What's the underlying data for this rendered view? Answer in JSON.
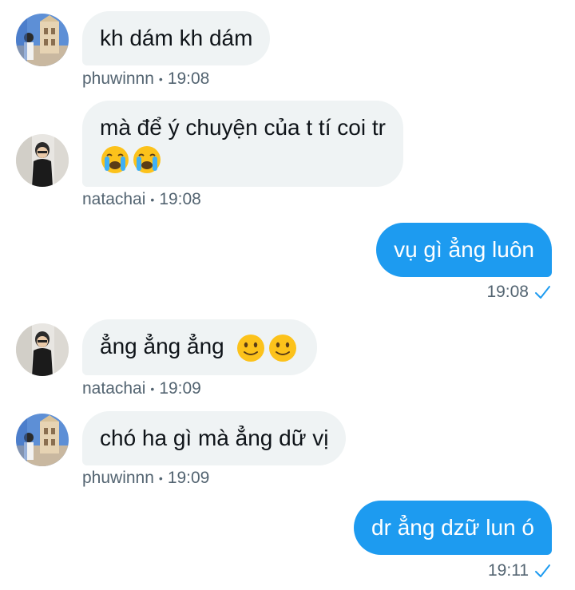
{
  "messages": [
    {
      "direction": "in",
      "avatar_icon": "avatar-building-photo",
      "text": "kh dám kh dám",
      "sender": "phuwinnn",
      "time": "19:08"
    },
    {
      "direction": "in",
      "avatar_icon": "avatar-person-photo",
      "text_line1": "mà để ý chuyện của t tí coi tr",
      "emoji_line2": [
        "crying-face-emoji",
        "crying-face-emoji"
      ],
      "sender": "natachai",
      "time": "19:08"
    },
    {
      "direction": "out",
      "text": "vụ gì ẳng luôn",
      "time": "19:08",
      "status_icon": "sent-check-icon"
    },
    {
      "direction": "in",
      "avatar_icon": "avatar-person-photo",
      "text": "ẳng ẳng ẳng",
      "emojis": [
        "slight-smile-emoji",
        "slight-smile-emoji"
      ],
      "sender": "natachai",
      "time": "19:09"
    },
    {
      "direction": "in",
      "avatar_icon": "avatar-building-photo",
      "text": "chó ha gì mà ẳng dữ vị",
      "sender": "phuwinnn",
      "time": "19:09"
    },
    {
      "direction": "out",
      "text": "dr ẳng dzữ lun ó",
      "time": "19:11",
      "status_icon": "sent-check-icon"
    }
  ],
  "meta_separator": "•",
  "colors": {
    "outgoing_bubble": "#1d9bf0",
    "incoming_bubble": "#eff3f4",
    "meta_text": "#536471"
  }
}
